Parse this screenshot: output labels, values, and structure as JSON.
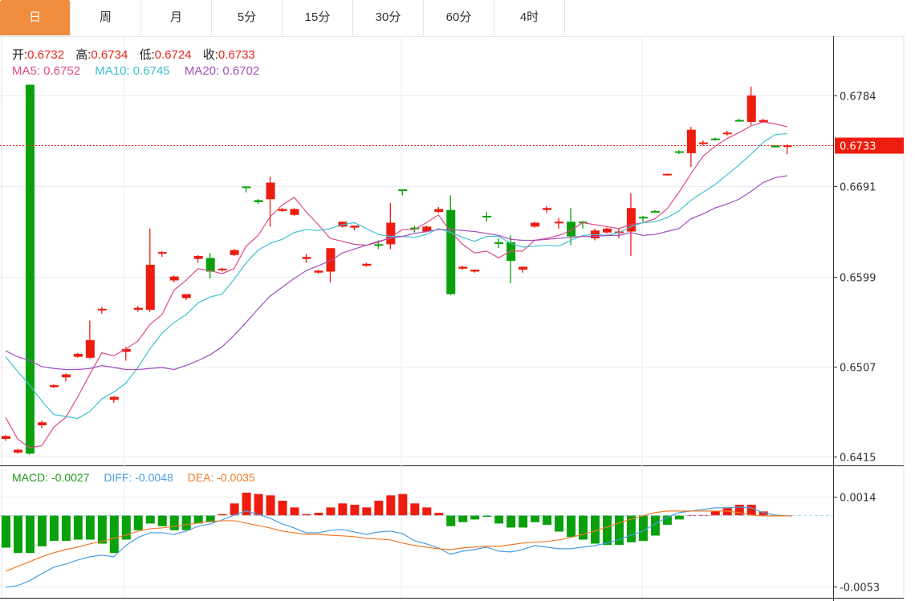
{
  "tabs": [
    "日",
    "周",
    "月",
    "5分",
    "15分",
    "30分",
    "60分",
    "4时"
  ],
  "active_tab": 0,
  "ohlc_info": {
    "open_label": "开:",
    "open": "0.6732",
    "high_label": "高:",
    "high": "0.6734",
    "low_label": "低:",
    "low": "0.6724",
    "close_label": "收:",
    "close": "0.6733"
  },
  "ma_info": {
    "ma5": "MA5: 0.6752",
    "ma10": "MA10: 0.6745",
    "ma20": "MA20: 0.6702"
  },
  "macd_info": {
    "macd": "MACD: -0.0027",
    "diff": "DIFF: -0.0048",
    "dea": "DEA: -0.0035"
  },
  "current_price_label": "0.6733",
  "colors": {
    "up": "#ee1c0e",
    "down": "#09a10b",
    "ma5": "#dd4b86",
    "ma10": "#3fc0d0",
    "ma20": "#a24fc0",
    "diff": "#4a9fe0",
    "dea": "#f07a28",
    "tab_active": "#f08c3e"
  },
  "chart_data": [
    {
      "type": "candlestick",
      "title": "K-line (daily)",
      "price_ticks": [
        "0.6784",
        "0.6691",
        "0.6599",
        "0.6507",
        "0.6415"
      ],
      "ylim": [
        0.6415,
        0.6784
      ],
      "current_price": 0.6733,
      "candles_ohlc": [
        [
          0.6433,
          0.6437,
          0.6431,
          0.6436
        ],
        [
          0.6419,
          0.6423,
          0.6418,
          0.6422
        ],
        [
          0.6795,
          0.6795,
          0.6417,
          0.6418
        ],
        [
          0.6447,
          0.6452,
          0.6444,
          0.645
        ],
        [
          0.6486,
          0.6489,
          0.6485,
          0.6488
        ],
        [
          0.6496,
          0.65,
          0.6492,
          0.6499
        ],
        [
          0.6517,
          0.6521,
          0.6516,
          0.652
        ],
        [
          0.6516,
          0.6554,
          0.6515,
          0.6534
        ],
        [
          0.6565,
          0.6568,
          0.6561,
          0.6566
        ],
        [
          0.6473,
          0.6477,
          0.647,
          0.6476
        ],
        [
          0.6522,
          0.6527,
          0.6513,
          0.6525
        ],
        [
          0.6565,
          0.6569,
          0.6563,
          0.6567
        ],
        [
          0.6565,
          0.6648,
          0.6563,
          0.6611
        ],
        [
          0.6623,
          0.6625,
          0.6619,
          0.6624
        ],
        [
          0.6595,
          0.66,
          0.6593,
          0.6599
        ],
        [
          0.6577,
          0.6581,
          0.6575,
          0.6581
        ],
        [
          0.6617,
          0.6621,
          0.6613,
          0.662
        ],
        [
          0.6618,
          0.6623,
          0.6597,
          0.6604
        ],
        [
          0.6606,
          0.6608,
          0.6604,
          0.6607
        ],
        [
          0.6621,
          0.6627,
          0.662,
          0.6626
        ],
        [
          0.6691,
          0.6691,
          0.6685,
          0.669
        ],
        [
          0.6677,
          0.6678,
          0.6673,
          0.6675
        ],
        [
          0.6678,
          0.6701,
          0.665,
          0.6695
        ],
        [
          0.6666,
          0.6669,
          0.6665,
          0.6668
        ],
        [
          0.6662,
          0.6669,
          0.6661,
          0.6668
        ],
        [
          0.6617,
          0.6622,
          0.6613,
          0.6619
        ],
        [
          0.6603,
          0.6606,
          0.6602,
          0.6605
        ],
        [
          0.6604,
          0.6628,
          0.6593,
          0.6628
        ],
        [
          0.665,
          0.6655,
          0.6649,
          0.6655
        ],
        [
          0.6649,
          0.6651,
          0.6646,
          0.6651
        ],
        [
          0.661,
          0.6613,
          0.6609,
          0.6612
        ],
        [
          0.6632,
          0.6636,
          0.6627,
          0.6631
        ],
        [
          0.6632,
          0.6674,
          0.6627,
          0.6654
        ],
        [
          0.6688,
          0.6688,
          0.6682,
          0.6687
        ],
        [
          0.6649,
          0.6651,
          0.6644,
          0.6648
        ],
        [
          0.6645,
          0.6651,
          0.6644,
          0.665
        ],
        [
          0.6665,
          0.667,
          0.6664,
          0.6668
        ],
        [
          0.6667,
          0.6682,
          0.658,
          0.6581
        ],
        [
          0.6607,
          0.661,
          0.6606,
          0.6609
        ],
        [
          0.6604,
          0.6606,
          0.6603,
          0.6606
        ],
        [
          0.6661,
          0.6665,
          0.6655,
          0.666
        ],
        [
          0.6634,
          0.6638,
          0.6628,
          0.6633
        ],
        [
          0.6634,
          0.6641,
          0.6592,
          0.6615
        ],
        [
          0.6606,
          0.6609,
          0.6603,
          0.6609
        ],
        [
          0.665,
          0.6655,
          0.6649,
          0.6654
        ],
        [
          0.6667,
          0.6671,
          0.6664,
          0.6669
        ],
        [
          0.6654,
          0.6659,
          0.6648,
          0.6655
        ],
        [
          0.6655,
          0.6669,
          0.6631,
          0.664
        ],
        [
          0.6655,
          0.6656,
          0.6648,
          0.6654
        ],
        [
          0.6638,
          0.6648,
          0.6636,
          0.6646
        ],
        [
          0.6644,
          0.6649,
          0.6643,
          0.6648
        ],
        [
          0.6644,
          0.6648,
          0.6638,
          0.6645
        ],
        [
          0.6645,
          0.6684,
          0.662,
          0.6669
        ],
        [
          0.666,
          0.6661,
          0.6655,
          0.6659
        ],
        [
          0.6666,
          0.6667,
          0.6664,
          0.6665
        ],
        [
          0.6703,
          0.6704,
          0.6702,
          0.6704
        ],
        [
          0.6727,
          0.6728,
          0.6724,
          0.6726
        ],
        [
          0.6725,
          0.6752,
          0.6711,
          0.6749
        ],
        [
          0.6735,
          0.6738,
          0.6733,
          0.6736
        ],
        [
          0.674,
          0.6741,
          0.6738,
          0.6739
        ],
        [
          0.6745,
          0.6748,
          0.6743,
          0.6746
        ],
        [
          0.6759,
          0.676,
          0.6757,
          0.6758
        ],
        [
          0.6757,
          0.6793,
          0.6754,
          0.6784
        ],
        [
          0.6757,
          0.676,
          0.6756,
          0.6759
        ],
        [
          0.6733,
          0.6733,
          0.6731,
          0.6731
        ],
        [
          0.6732,
          0.6734,
          0.6724,
          0.6733
        ]
      ],
      "series": [
        {
          "name": "MA5",
          "values": [
            0.6455,
            0.6433,
            0.6424,
            0.6426,
            0.6445,
            0.6455,
            0.6476,
            0.6499,
            0.6521,
            0.6518,
            0.6525,
            0.6533,
            0.655,
            0.656,
            0.6585,
            0.6595,
            0.6607,
            0.6605,
            0.6602,
            0.6607,
            0.663,
            0.6641,
            0.666,
            0.6672,
            0.668,
            0.6665,
            0.6652,
            0.6638,
            0.6635,
            0.6632,
            0.6631,
            0.6634,
            0.6639,
            0.6647,
            0.6647,
            0.6654,
            0.6662,
            0.6645,
            0.6632,
            0.6623,
            0.6625,
            0.6618,
            0.6625,
            0.6625,
            0.6636,
            0.6638,
            0.6641,
            0.6646,
            0.6654,
            0.6652,
            0.665,
            0.6648,
            0.6652,
            0.6654,
            0.6658,
            0.6668,
            0.6685,
            0.6704,
            0.6722,
            0.6732,
            0.674,
            0.6746,
            0.6753,
            0.6757,
            0.6755,
            0.6752
          ]
        },
        {
          "name": "MA10",
          "values": [
            0.6517,
            0.6502,
            0.6488,
            0.6472,
            0.6458,
            0.6456,
            0.6454,
            0.6461,
            0.6474,
            0.6481,
            0.649,
            0.6506,
            0.6525,
            0.6541,
            0.6552,
            0.656,
            0.6572,
            0.6578,
            0.6581,
            0.6596,
            0.6613,
            0.6626,
            0.6633,
            0.6637,
            0.6644,
            0.6647,
            0.6646,
            0.6648,
            0.6652,
            0.6654,
            0.6648,
            0.6642,
            0.664,
            0.664,
            0.6639,
            0.6642,
            0.6648,
            0.6644,
            0.6639,
            0.6635,
            0.664,
            0.664,
            0.6633,
            0.6629,
            0.663,
            0.6631,
            0.663,
            0.6636,
            0.6641,
            0.6642,
            0.6641,
            0.6644,
            0.665,
            0.6654,
            0.6655,
            0.6659,
            0.6666,
            0.6677,
            0.6685,
            0.6693,
            0.6703,
            0.6713,
            0.6724,
            0.6736,
            0.6744,
            0.6745
          ]
        },
        {
          "name": "MA20",
          "values": [
            0.6523,
            0.6517,
            0.6513,
            0.6507,
            0.6505,
            0.6504,
            0.6504,
            0.6505,
            0.6508,
            0.6506,
            0.6504,
            0.6504,
            0.6505,
            0.6506,
            0.6504,
            0.6508,
            0.6513,
            0.6519,
            0.6527,
            0.6539,
            0.6552,
            0.6566,
            0.6579,
            0.6588,
            0.6597,
            0.6605,
            0.661,
            0.6615,
            0.6623,
            0.6627,
            0.6631,
            0.6635,
            0.6638,
            0.664,
            0.6643,
            0.6645,
            0.6647,
            0.6647,
            0.6646,
            0.6645,
            0.6643,
            0.6641,
            0.6637,
            0.6636,
            0.6636,
            0.6637,
            0.6638,
            0.6639,
            0.664,
            0.664,
            0.6641,
            0.6641,
            0.6644,
            0.6641,
            0.6642,
            0.6645,
            0.6648,
            0.6658,
            0.6663,
            0.6669,
            0.6673,
            0.6678,
            0.6686,
            0.6695,
            0.67,
            0.6702
          ]
        }
      ]
    },
    {
      "type": "bar",
      "title": "MACD",
      "ticks": [
        "0.0014",
        "-0.0053"
      ],
      "ylim": [
        -0.0053,
        0.0014
      ],
      "macd_hist": [
        -0.0024,
        -0.0028,
        -0.0028,
        -0.0023,
        -0.0019,
        -0.0019,
        -0.0018,
        -0.0018,
        -0.0021,
        -0.0028,
        -0.0018,
        -0.0011,
        -0.0006,
        -0.0008,
        -0.0011,
        -0.0011,
        -0.0006,
        -0.0005,
        0.0001,
        0.0009,
        0.0017,
        0.0016,
        0.0015,
        0.0011,
        0.0006,
        0.0001,
        0.0002,
        0.0006,
        0.0009,
        0.0008,
        0.0006,
        0.0011,
        0.0015,
        0.0016,
        0.0009,
        0.0006,
        0.0002,
        -0.0008,
        -0.0005,
        -0.0003,
        -0.0001,
        -0.0006,
        -0.0009,
        -0.0009,
        -0.0005,
        -0.0007,
        -0.0012,
        -0.0016,
        -0.0018,
        -0.0021,
        -0.0022,
        -0.0022,
        -0.002,
        -0.0019,
        -0.0015,
        -0.0007,
        -0.0003,
        3e-05,
        3e-05,
        0.0003,
        0.0006,
        0.0008,
        0.0008,
        0.0003,
        0.0,
        0.0
      ],
      "series": [
        {
          "name": "DIFF",
          "values": [
            -0.00535,
            -0.00523,
            -0.00487,
            -0.00434,
            -0.00386,
            -0.00362,
            -0.00332,
            -0.00308,
            -0.00296,
            -0.00308,
            -0.00224,
            -0.00164,
            -0.00129,
            -0.00129,
            -0.00141,
            -0.00117,
            -0.00081,
            -0.00063,
            -0.00033,
            3e-05,
            0.00033,
            9e-05,
            -0.00021,
            -0.00063,
            -0.00093,
            -0.00129,
            -0.00129,
            -0.00111,
            -0.00105,
            -0.00123,
            -0.00141,
            -0.00123,
            -0.00117,
            -0.00135,
            -0.00188,
            -0.00212,
            -0.00242,
            -0.0029,
            -0.00266,
            -0.00254,
            -0.00236,
            -0.00266,
            -0.00272,
            -0.00254,
            -0.00224,
            -0.00236,
            -0.00248,
            -0.00248,
            -0.00236,
            -0.00224,
            -0.00206,
            -0.00182,
            -0.00147,
            -0.00117,
            -0.00063,
            -0.00015,
            0.00021,
            0.00033,
            0.00045,
            0.00057,
            0.00057,
            0.00063,
            0.00057,
            0.00021,
            3e-05,
            -3e-05
          ]
        },
        {
          "name": "DEA",
          "values": [
            -0.00416,
            -0.0038,
            -0.00344,
            -0.00308,
            -0.00278,
            -0.00254,
            -0.00236,
            -0.00212,
            -0.00194,
            -0.0017,
            -0.00147,
            -0.00117,
            -0.00099,
            -0.00093,
            -0.00081,
            -0.00069,
            -0.00057,
            -0.00045,
            -0.00039,
            -0.00039,
            -0.00057,
            -0.00075,
            -0.00093,
            -0.00117,
            -0.00129,
            -0.00141,
            -0.00141,
            -0.00147,
            -0.00152,
            -0.00158,
            -0.0017,
            -0.00176,
            -0.00182,
            -0.00206,
            -0.00224,
            -0.00236,
            -0.00248,
            -0.00254,
            -0.00242,
            -0.00236,
            -0.0023,
            -0.0023,
            -0.00218,
            -0.00206,
            -0.002,
            -0.00194,
            -0.00182,
            -0.00164,
            -0.00141,
            -0.00117,
            -0.00087,
            -0.00057,
            -0.00027,
            -3e-05,
            0.00021,
            0.00033,
            0.00033,
            0.00033,
            0.00033,
            0.00033,
            0.00033,
            0.00021,
            3e-05,
            -3e-05,
            -3e-05,
            -3e-05
          ]
        }
      ]
    }
  ]
}
